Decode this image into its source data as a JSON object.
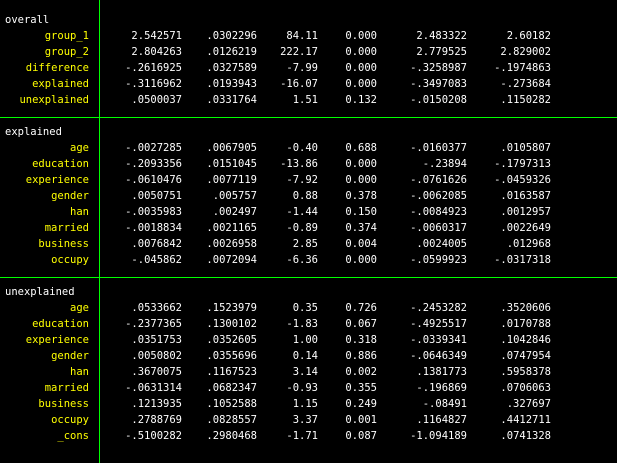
{
  "sections": [
    {
      "title": "overall",
      "rows": [
        {
          "label": "group_1",
          "values": [
            "2.542571",
            ".0302296",
            "84.11",
            "0.000",
            "2.483322",
            "2.60182"
          ]
        },
        {
          "label": "group_2",
          "values": [
            "2.804263",
            ".0126219",
            "222.17",
            "0.000",
            "2.779525",
            "2.829002"
          ]
        },
        {
          "label": "difference",
          "values": [
            "-.2616925",
            ".0327589",
            "-7.99",
            "0.000",
            "-.3258987",
            "-.1974863"
          ]
        },
        {
          "label": "explained",
          "values": [
            "-.3116962",
            ".0193943",
            "-16.07",
            "0.000",
            "-.3497083",
            "-.273684"
          ]
        },
        {
          "label": "unexplained",
          "values": [
            ".0500037",
            ".0331764",
            "1.51",
            "0.132",
            "-.0150208",
            ".1150282"
          ]
        }
      ]
    },
    {
      "title": "explained",
      "rows": [
        {
          "label": "age",
          "values": [
            "-.0027285",
            ".0067905",
            "-0.40",
            "0.688",
            "-.0160377",
            ".0105807"
          ]
        },
        {
          "label": "education",
          "values": [
            "-.2093356",
            ".0151045",
            "-13.86",
            "0.000",
            "-.23894",
            "-.1797313"
          ]
        },
        {
          "label": "experience",
          "values": [
            "-.0610476",
            ".0077119",
            "-7.92",
            "0.000",
            "-.0761626",
            "-.0459326"
          ]
        },
        {
          "label": "gender",
          "values": [
            ".0050751",
            ".005757",
            "0.88",
            "0.378",
            "-.0062085",
            ".0163587"
          ]
        },
        {
          "label": "han",
          "values": [
            "-.0035983",
            ".002497",
            "-1.44",
            "0.150",
            "-.0084923",
            ".0012957"
          ]
        },
        {
          "label": "married",
          "values": [
            "-.0018834",
            ".0021165",
            "-0.89",
            "0.374",
            "-.0060317",
            ".0022649"
          ]
        },
        {
          "label": "business",
          "values": [
            ".0076842",
            ".0026958",
            "2.85",
            "0.004",
            ".0024005",
            ".012968"
          ]
        },
        {
          "label": "occupy",
          "values": [
            "-.045862",
            ".0072094",
            "-6.36",
            "0.000",
            "-.0599923",
            "-.0317318"
          ]
        }
      ]
    },
    {
      "title": "unexplained",
      "rows": [
        {
          "label": "age",
          "values": [
            ".0533662",
            ".1523979",
            "0.35",
            "0.726",
            "-.2453282",
            ".3520606"
          ]
        },
        {
          "label": "education",
          "values": [
            "-.2377365",
            ".1300102",
            "-1.83",
            "0.067",
            "-.4925517",
            ".0170788"
          ]
        },
        {
          "label": "experience",
          "values": [
            ".0351753",
            ".0352605",
            "1.00",
            "0.318",
            "-.0339341",
            ".1042846"
          ]
        },
        {
          "label": "gender",
          "values": [
            ".0050802",
            ".0355696",
            "0.14",
            "0.886",
            "-.0646349",
            ".0747954"
          ]
        },
        {
          "label": "han",
          "values": [
            ".3670075",
            ".1167523",
            "3.14",
            "0.002",
            ".1381773",
            ".5958378"
          ]
        },
        {
          "label": "married",
          "values": [
            "-.0631314",
            ".0682347",
            "-0.93",
            "0.355",
            "-.196869",
            ".0706063"
          ]
        },
        {
          "label": "business",
          "values": [
            ".1213935",
            ".1052588",
            "1.15",
            "0.249",
            "-.08491",
            ".327697"
          ]
        },
        {
          "label": "occupy",
          "values": [
            ".2788769",
            ".0828557",
            "3.37",
            "0.001",
            ".1164827",
            ".4412711"
          ]
        },
        {
          "label": "_cons",
          "values": [
            "-.5100282",
            ".2980468",
            "-1.71",
            "0.087",
            "-1.094189",
            ".0741328"
          ]
        }
      ]
    }
  ]
}
